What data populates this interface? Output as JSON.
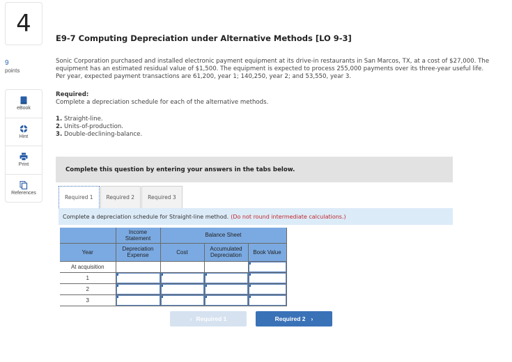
{
  "question": {
    "number": "4",
    "points_value": "9",
    "points_label": "points",
    "title": "E9-7 Computing Depreciation under Alternative Methods [LO 9-3]",
    "paragraph": "Sonic Corporation purchased and installed electronic payment equipment at its drive-in restaurants in San Marcos, TX, at a cost of $27,000. The equipment has an estimated residual value of $1,500. The equipment is expected to process 255,000 payments over its three-year useful life. Per year, expected payment transactions are 61,200, year 1; 140,250, year 2; and 53,550, year 3.",
    "required_heading": "Required:",
    "required_text": "Complete a depreciation schedule for each of the alternative methods.",
    "methods": [
      {
        "num": "1.",
        "label": "Straight-line."
      },
      {
        "num": "2.",
        "label": "Units-of-production."
      },
      {
        "num": "3.",
        "label": "Double-declining-balance."
      }
    ]
  },
  "tools": [
    {
      "label": "eBook",
      "icon": "book-icon"
    },
    {
      "label": "Hint",
      "icon": "lifebuoy-icon"
    },
    {
      "label": "Print",
      "icon": "printer-icon"
    },
    {
      "label": "References",
      "icon": "documents-icon"
    }
  ],
  "banner": "Complete this question by entering your answers in the tabs below.",
  "tabs": [
    {
      "label": "Required 1",
      "active": true
    },
    {
      "label": "Required 2",
      "active": false
    },
    {
      "label": "Required 3",
      "active": false
    }
  ],
  "instruction": {
    "text": "Complete a depreciation schedule for Straight-line method.",
    "warning": "(Do not round intermediate calculations.)"
  },
  "table": {
    "group_headers": {
      "income_statement": "Income Statement",
      "balance_sheet": "Balance Sheet"
    },
    "columns": {
      "year": "Year",
      "depreciation_expense": "Depreciation Expense",
      "cost": "Cost",
      "accumulated_depreciation": "Accumulated Depreciation",
      "book_value": "Book Value"
    },
    "rows": [
      {
        "year": "At acquisition",
        "depreciation_expense": "",
        "cost": "",
        "accumulated_depreciation": "",
        "book_value": ""
      },
      {
        "year": "1",
        "depreciation_expense": "",
        "cost": "",
        "accumulated_depreciation": "",
        "book_value": ""
      },
      {
        "year": "2",
        "depreciation_expense": "",
        "cost": "",
        "accumulated_depreciation": "",
        "book_value": ""
      },
      {
        "year": "3",
        "depreciation_expense": "",
        "cost": "",
        "accumulated_depreciation": "",
        "book_value": ""
      }
    ]
  },
  "navigation": {
    "prev_label": "Required 1",
    "next_label": "Required 2",
    "prev_icon": "‹",
    "next_icon": "›"
  },
  "colors": {
    "header_blue": "#7baae2",
    "instruction_bg": "#dcebf8",
    "warning_red": "#c0282e",
    "next_button": "#3a72b8",
    "prev_button_disabled": "#d6e2f0"
  }
}
